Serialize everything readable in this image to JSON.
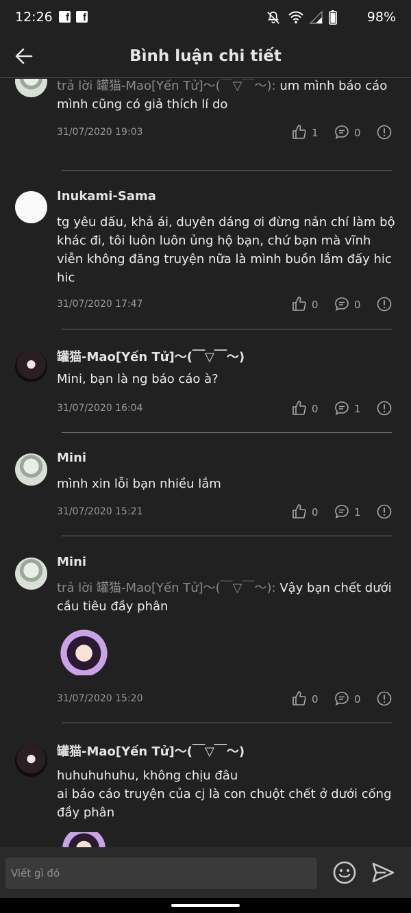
{
  "status_bar": {
    "time": "12:26",
    "notification_icons": [
      "facebook-icon",
      "facebook-icon"
    ],
    "system_icons": [
      "notifications-off-icon",
      "wifi-icon",
      "cell-signal-icon",
      "battery-icon"
    ],
    "battery": "98%"
  },
  "header": {
    "title": "Bình luận chi tiết",
    "back_icon": "arrow-left-icon"
  },
  "comments": [
    {
      "author": "",
      "reply_prefix": "trả lời 罐猫-Mao[Yến Tử]〜(￣▽￣〜): ",
      "text": "um mình báo cáo mình cũng có giả thích lí do",
      "date": "31/07/2020 19:03",
      "likes": "1",
      "replies": "0"
    },
    {
      "author": "Inukami-Sama",
      "reply_prefix": "",
      "text": "tg yêu dấu, khả ái, duyên dáng ơi đừng nản chí làm bộ khác đi, tôi luôn luôn ủng hộ bạn, chứ bạn mà vĩnh viễn không đăng truyện nữa là mình buồn lắm đấy hic hic",
      "date": "31/07/2020 17:47",
      "likes": "0",
      "replies": "0"
    },
    {
      "author": "罐猫-Mao[Yến Tử]〜(￣▽￣〜)",
      "reply_prefix": "",
      "text": "Mini, bạn là ng báo cáo à?",
      "date": "31/07/2020 16:04",
      "likes": "0",
      "replies": "1"
    },
    {
      "author": "Mini",
      "reply_prefix": "",
      "text": "mình xin lỗi bạn nhiều lắm",
      "date": "31/07/2020 15:21",
      "likes": "0",
      "replies": "1"
    },
    {
      "author": "Mini",
      "reply_prefix": "trả lời 罐猫-Mao[Yến Tử]〜(￣▽￣〜): ",
      "text": "Vậy bạn chết dưới cầu tiêu đầy phân",
      "date": "31/07/2020 15:20",
      "likes": "0",
      "replies": "0"
    },
    {
      "author": "罐猫-Mao[Yến Tử]〜(￣▽￣〜)",
      "reply_prefix": "",
      "text_line1": "huhuhuhuhu, không chịu đâu",
      "text_line2": "ai báo cáo truyện của cj là con chuột chết ở dưới cống đầy phân"
    }
  ],
  "composer": {
    "placeholder": "Viết gì đó",
    "emoji_icon": "emoji-icon",
    "send_icon": "send-icon"
  },
  "colors": {
    "background": "#212121",
    "text": "#ececec",
    "muted": "#9a9a9a",
    "divider": "#6a6a6a"
  }
}
